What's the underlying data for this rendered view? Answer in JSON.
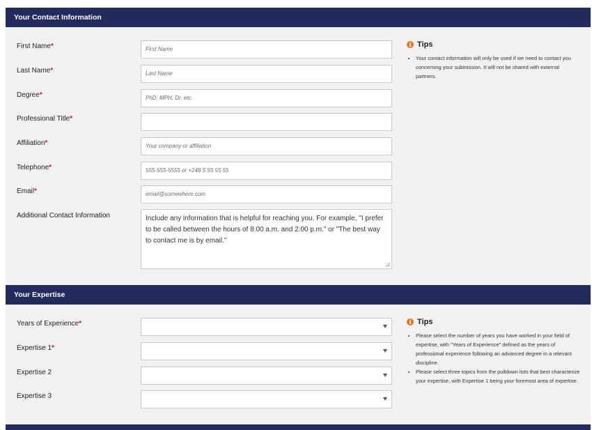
{
  "contact": {
    "header": "Your Contact Information",
    "fields": [
      {
        "label": "First Name",
        "required": "*",
        "placeholder": "First Name"
      },
      {
        "label": "Last Name",
        "required": "*",
        "placeholder": "Last Name"
      },
      {
        "label": "Degree",
        "required": "*",
        "placeholder": "PhD, MPH, Dr, etc."
      },
      {
        "label": "Professional Title",
        "required": "*",
        "placeholder": ""
      },
      {
        "label": "Affiliation",
        "required": "*",
        "placeholder": "Your company or affiliation"
      },
      {
        "label": "Telephone",
        "required": "*",
        "placeholder": "555-555-5555 or +248 5 55 55 55"
      },
      {
        "label": "Email",
        "required": "*",
        "placeholder": "email@somewhere.com"
      }
    ],
    "additional": {
      "label": "Additional Contact Information",
      "value": "Include any information that is helpful for reaching you. For example, \"I prefer to be called between the hours of 8:00 a.m. and 2:00 p.m.\" or \"The best way to contact me is by email.\""
    },
    "tips": {
      "title": "Tips",
      "items": [
        "Your contact information will only be used if we need to contact you concerning your submission. It will not be shared with external partners."
      ]
    }
  },
  "expertise": {
    "header": "Your Expertise",
    "fields": [
      {
        "label": "Years of Experience",
        "required": "*"
      },
      {
        "label": "Expertise 1",
        "required": "*"
      },
      {
        "label": "Expertise 2",
        "required": ""
      },
      {
        "label": "Expertise 3",
        "required": ""
      }
    ],
    "tips": {
      "title": "Tips",
      "items": [
        "Please select the number of years you have worked in your field of expertise, with \"Years of Experience\" defined as the years of professional experience following an advanced degree in a relevant discipline.",
        "Please select three topics from the pulldown lists that best characterize your expertise, with Expertise 1 being your foremost area of expertise."
      ]
    }
  },
  "colors": {
    "header_bg": "#232a5c",
    "required": "#c0202a",
    "tip_icon": "#e07a2b",
    "panel_bg": "#f1f1f1"
  },
  "icons": {
    "tip": "info-icon",
    "select": "chevron-down-icon",
    "textarea": "resize-grip-icon"
  }
}
